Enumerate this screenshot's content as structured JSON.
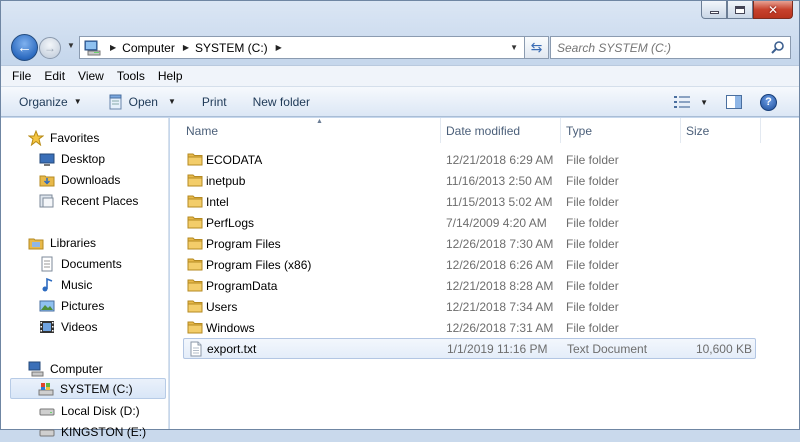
{
  "address": {
    "crumbs": [
      "Computer",
      "SYSTEM (C:)"
    ]
  },
  "search": {
    "placeholder": "Search SYSTEM (C:)"
  },
  "menu": [
    "File",
    "Edit",
    "View",
    "Tools",
    "Help"
  ],
  "toolbar": {
    "organize": "Organize",
    "open": "Open",
    "print": "Print",
    "new_folder": "New folder"
  },
  "nav": {
    "favorites": "Favorites",
    "favorites_items": [
      "Desktop",
      "Downloads",
      "Recent Places"
    ],
    "libraries": "Libraries",
    "libraries_items": [
      "Documents",
      "Music",
      "Pictures",
      "Videos"
    ],
    "computer": "Computer",
    "computer_items": [
      "SYSTEM (C:)",
      "Local Disk (D:)",
      "KINGSTON (E:)"
    ]
  },
  "columns": {
    "name": "Name",
    "date": "Date modified",
    "type": "Type",
    "size": "Size"
  },
  "files": [
    {
      "name": "ECODATA",
      "date": "12/21/2018 6:29 AM",
      "type": "File folder",
      "size": ""
    },
    {
      "name": "inetpub",
      "date": "11/16/2013 2:50 AM",
      "type": "File folder",
      "size": ""
    },
    {
      "name": "Intel",
      "date": "11/15/2013 5:02 AM",
      "type": "File folder",
      "size": ""
    },
    {
      "name": "PerfLogs",
      "date": "7/14/2009 4:20 AM",
      "type": "File folder",
      "size": ""
    },
    {
      "name": "Program Files",
      "date": "12/26/2018 7:30 AM",
      "type": "File folder",
      "size": ""
    },
    {
      "name": "Program Files (x86)",
      "date": "12/26/2018 6:26 AM",
      "type": "File folder",
      "size": ""
    },
    {
      "name": "ProgramData",
      "date": "12/21/2018 8:28 AM",
      "type": "File folder",
      "size": ""
    },
    {
      "name": "Users",
      "date": "12/21/2018 7:34 AM",
      "type": "File folder",
      "size": ""
    },
    {
      "name": "Windows",
      "date": "12/26/2018 7:31 AM",
      "type": "File folder",
      "size": ""
    },
    {
      "name": "export.txt",
      "date": "1/1/2019 11:16 PM",
      "type": "Text Document",
      "size": "10,600 KB"
    }
  ],
  "colors": {
    "folder": "#e8b94a",
    "selection": "#d9e6f7",
    "accent": "#2d6bc0"
  }
}
